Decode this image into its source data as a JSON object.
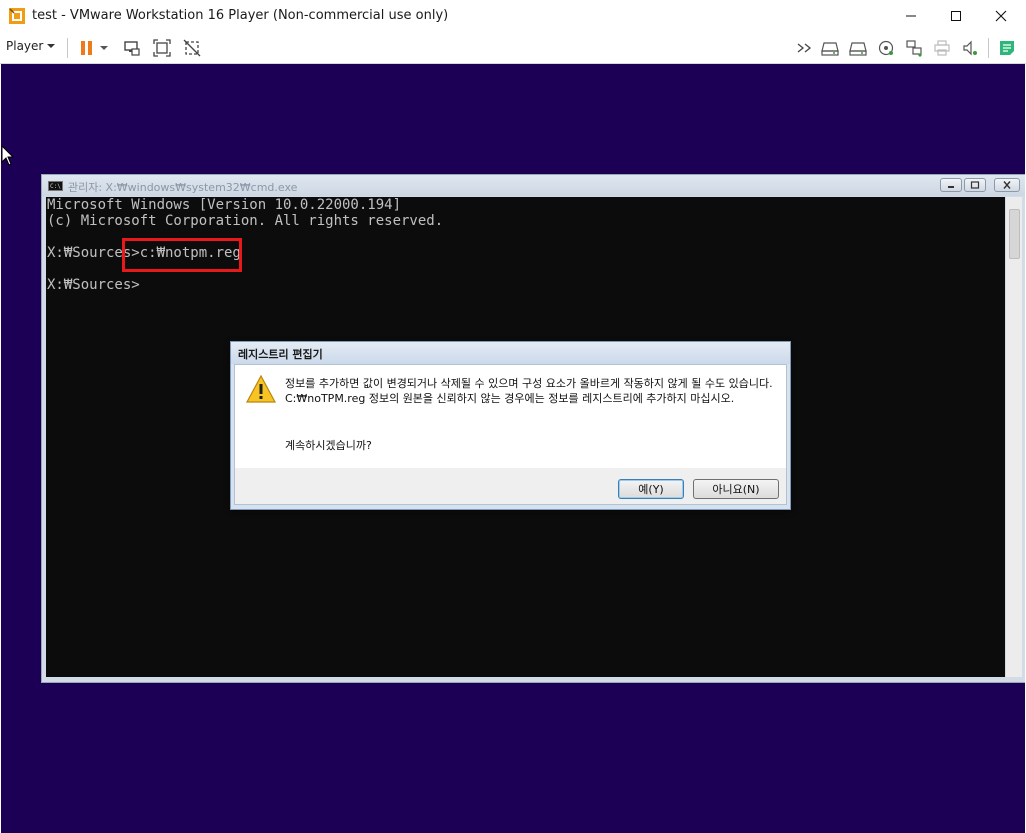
{
  "window": {
    "title": "test - VMware Workstation 16 Player (Non-commercial use only)",
    "app_icon": "vmware-player-icon",
    "controls": [
      "minimize-icon",
      "maximize-icon",
      "close-icon"
    ]
  },
  "toolbar": {
    "player_menu_label": "Player",
    "icons": [
      "pause-icon",
      "dropdown-arrow-icon",
      "send-ctrl-alt-del-icon",
      "fit-guest-icon",
      "unity-mode-icon",
      "more-icon",
      "hard-disk-icon",
      "hard-disk-2-icon",
      "cd-dvd-icon",
      "network-adapter-icon",
      "printer-icon",
      "sound-card-icon",
      "notes-icon"
    ]
  },
  "cmd": {
    "title": "관리자: X:₩windows₩system32₩cmd.exe",
    "lines": [
      "Microsoft Windows [Version 10.0.22000.194]",
      "(c) Microsoft Corporation. All rights reserved.",
      "",
      "X:₩Sources>c:₩notpm.reg",
      "",
      "X:₩Sources>"
    ]
  },
  "dialog": {
    "title": "레지스트리 편집기",
    "message": "정보를 추가하면 값이 변경되거나 삭제될 수 있으며 구성 요소가 올바르게 작동하지 않게 될 수도 있습니다. C:₩noTPM.reg 정보의 원본을 신뢰하지 않는 경우에는 정보를 레지스트리에 추가하지 마십시오.",
    "question": "계속하시겠습니까?",
    "yes_label": "예(Y)",
    "no_label": "아니요(N)"
  },
  "colors": {
    "vm_background": "#1c0056",
    "console_background": "#0c0c0c",
    "console_text": "#c0c0c0",
    "highlight_box": "#e8191b"
  }
}
